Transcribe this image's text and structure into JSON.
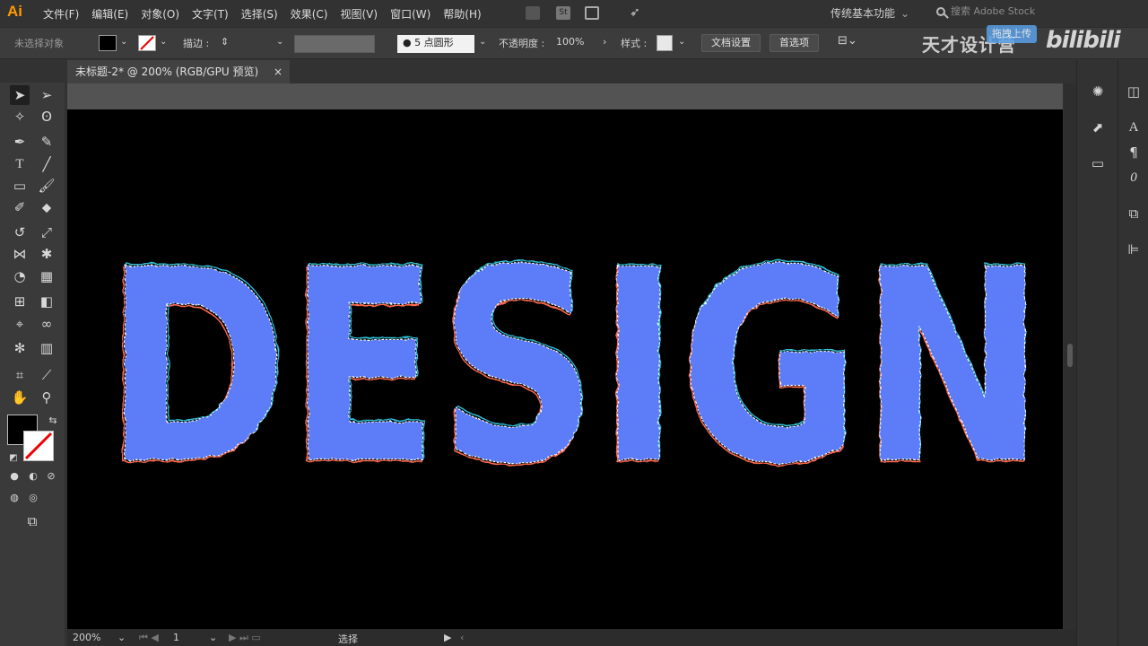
{
  "app": {
    "logo": "Ai"
  },
  "menu": [
    "文件(F)",
    "编辑(E)",
    "对象(O)",
    "文字(T)",
    "选择(S)",
    "效果(C)",
    "视图(V)",
    "窗口(W)",
    "帮助(H)"
  ],
  "workspace": {
    "label": "传统基本功能"
  },
  "search": {
    "placeholder": "搜索 Adobe Stock"
  },
  "control": {
    "selection_label": "未选择对象",
    "stroke_label": "描边 :",
    "brush_size": "5",
    "brush_label": "点圆形",
    "opacity_label": "不透明度 :",
    "opacity_value": "100%",
    "style_label": "样式 :",
    "doc_settings": "文档设置",
    "preferences": "首选项"
  },
  "watermark": {
    "text": "天才设计营",
    "upload": "拖拽上传",
    "bili": "bilibili"
  },
  "tab": {
    "title": "未标题-2* @ 200% (RGB/GPU 预览)",
    "close": "×"
  },
  "canvas": {
    "text": "DESIGN",
    "fill_color": "#5b7cf8",
    "stroke_colors": [
      "#ff6a4d",
      "#2ec4d8",
      "#ffffff"
    ]
  },
  "status": {
    "zoom": "200%",
    "artboard": "1",
    "mode": "选择"
  },
  "colors": {
    "fill": "#000000",
    "stroke": "#ffffff",
    "accent": "#ff9a00"
  }
}
